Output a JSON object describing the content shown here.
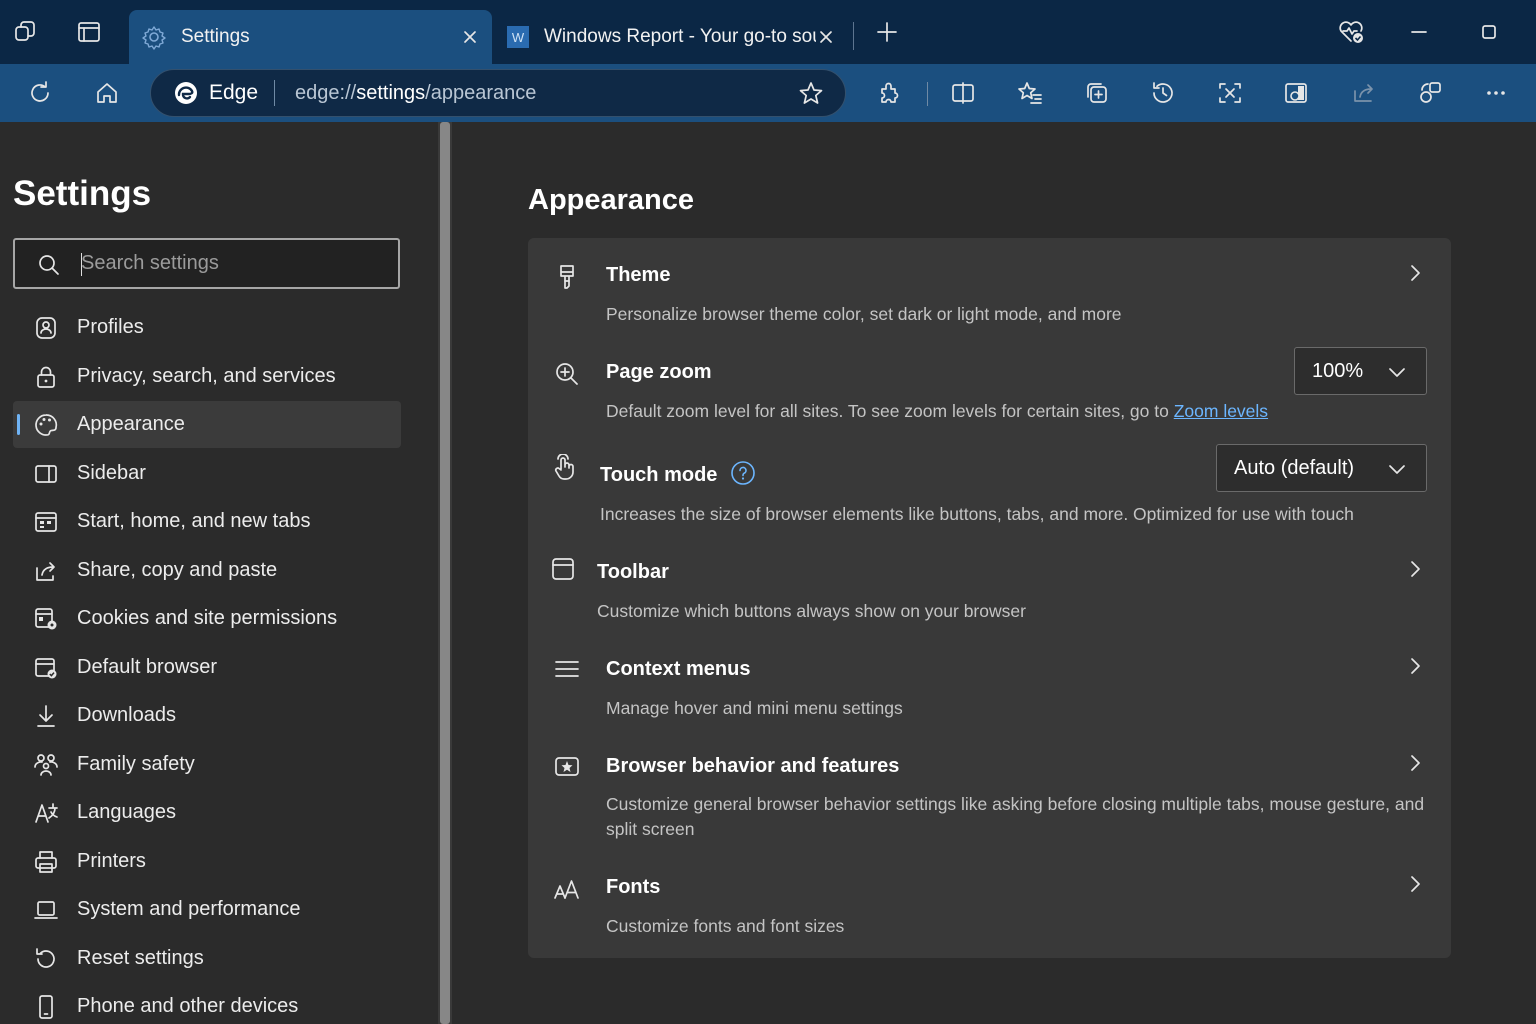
{
  "tabs": [
    {
      "title": "Settings",
      "active": true
    },
    {
      "title": "Windows Report - Your go-to sou",
      "active": false
    }
  ],
  "address_bar": {
    "browser_label": "Edge",
    "url_prefix": "edge://",
    "url_mid": "settings",
    "url_suffix": "/appearance"
  },
  "sidebar": {
    "title": "Settings",
    "search_placeholder": "Search settings",
    "items": [
      {
        "label": "Profiles",
        "icon": "profile-icon"
      },
      {
        "label": "Privacy, search, and services",
        "icon": "lock-icon"
      },
      {
        "label": "Appearance",
        "icon": "palette-icon",
        "selected": true
      },
      {
        "label": "Sidebar",
        "icon": "sidebar-icon"
      },
      {
        "label": "Start, home, and new tabs",
        "icon": "start-icon"
      },
      {
        "label": "Share, copy and paste",
        "icon": "share-icon"
      },
      {
        "label": "Cookies and site permissions",
        "icon": "cookies-icon"
      },
      {
        "label": "Default browser",
        "icon": "default-browser-icon"
      },
      {
        "label": "Downloads",
        "icon": "download-icon"
      },
      {
        "label": "Family safety",
        "icon": "family-icon"
      },
      {
        "label": "Languages",
        "icon": "languages-icon"
      },
      {
        "label": "Printers",
        "icon": "printer-icon"
      },
      {
        "label": "System and performance",
        "icon": "system-icon"
      },
      {
        "label": "Reset settings",
        "icon": "reset-icon"
      },
      {
        "label": "Phone and other devices",
        "icon": "phone-icon"
      }
    ]
  },
  "main": {
    "title": "Appearance",
    "rows": {
      "theme": {
        "title": "Theme",
        "desc": "Personalize browser theme color, set dark or light mode, and more"
      },
      "zoom": {
        "title": "Page zoom",
        "desc_prefix": "Default zoom level for all sites. To see zoom levels for certain sites, go to ",
        "link": "Zoom levels",
        "value": "100%"
      },
      "touch": {
        "title": "Touch mode",
        "desc": "Increases the size of browser elements like buttons, tabs, and more. Optimized for use with touch",
        "value": "Auto (default)"
      },
      "toolbar": {
        "title": "Toolbar",
        "desc": "Customize which buttons always show on your browser"
      },
      "context": {
        "title": "Context menus",
        "desc": "Manage hover and mini menu settings"
      },
      "behavior": {
        "title": "Browser behavior and features",
        "desc": "Customize general browser behavior settings like asking before closing multiple tabs, mouse gesture, and split screen"
      },
      "fonts": {
        "title": "Fonts",
        "desc": "Customize fonts and font sizes"
      }
    }
  },
  "colors": {
    "titlebar": "#0b2745",
    "toolbar": "#1b4f7f",
    "background": "#2b2b2b",
    "card": "#393939",
    "accent": "#6cb6ff"
  }
}
